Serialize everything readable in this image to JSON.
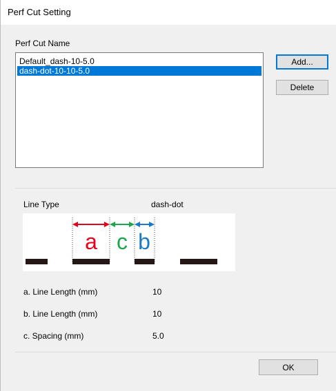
{
  "window": {
    "title": "Perf Cut Setting"
  },
  "name_section": {
    "label": "Perf Cut Name",
    "items": [
      {
        "label": "Default_dash-10-5.0",
        "selected": false
      },
      {
        "label": "dash-dot-10-10-5.0",
        "selected": true
      }
    ]
  },
  "buttons": {
    "add": "Add...",
    "delete": "Delete",
    "ok": "OK"
  },
  "details": {
    "line_type_label": "Line Type",
    "line_type_value": "dash-dot",
    "illustration": {
      "letters": [
        "a",
        "c",
        "b"
      ],
      "colors": {
        "a": "#e8001c",
        "c": "#1aa84a",
        "b": "#1a7ac8",
        "dash": "#231815"
      }
    },
    "a_label": "a. Line Length (mm)",
    "a_value": "10",
    "b_label": "b. Line Length (mm)",
    "b_value": "10",
    "c_label": "c. Spacing (mm)",
    "c_value": "5.0"
  },
  "colors": {
    "selection": "#0078d7",
    "dialog_bg": "#f0f0f0"
  }
}
